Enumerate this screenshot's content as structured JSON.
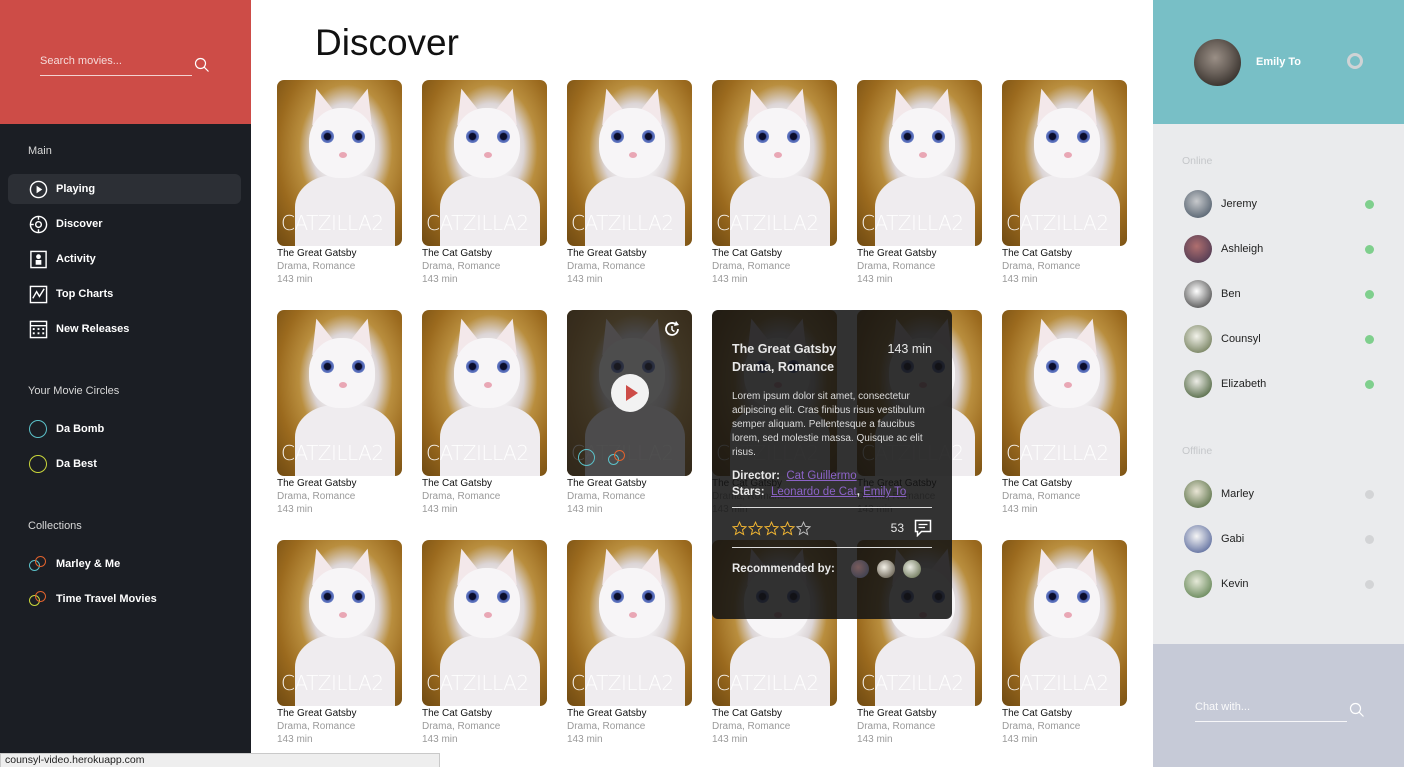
{
  "search": {
    "placeholder": "Search movies..."
  },
  "sidebar": {
    "main_title": "Main",
    "nav": [
      {
        "label": "Playing",
        "icon": "play-circle-icon",
        "active": true
      },
      {
        "label": "Discover",
        "icon": "compass-icon"
      },
      {
        "label": "Activity",
        "icon": "activity-icon"
      },
      {
        "label": "Top Charts",
        "icon": "chart-icon"
      },
      {
        "label": "New Releases",
        "icon": "calendar-icon"
      }
    ],
    "circles_title": "Your Movie Circles",
    "circles": [
      {
        "label": "Da Bomb",
        "color": "#5bc0c8"
      },
      {
        "label": "Da Best",
        "color": "#c9d63a"
      }
    ],
    "collections_title": "Collections",
    "collections": [
      {
        "label": "Marley & Me",
        "colors": [
          "#5bc0c8",
          "#e0622d"
        ]
      },
      {
        "label": "Time Travel Movies",
        "colors": [
          "#c9d63a",
          "#e0622d"
        ]
      }
    ]
  },
  "main": {
    "title": "Discover",
    "poster_text": "CATZILLA2",
    "movies": [
      {
        "name": "The Great Gatsby",
        "genre": "Drama, Romance",
        "duration": "143 min"
      },
      {
        "name": "The Cat Gatsby",
        "genre": "Drama, Romance",
        "duration": "143 min"
      },
      {
        "name": "The Great Gatsby",
        "genre": "Drama, Romance",
        "duration": "143 min"
      },
      {
        "name": "The Cat Gatsby",
        "genre": "Drama, Romance",
        "duration": "143 min"
      },
      {
        "name": "The Great Gatsby",
        "genre": "Drama, Romance",
        "duration": "143 min"
      },
      {
        "name": "The Cat Gatsby",
        "genre": "Drama, Romance",
        "duration": "143 min"
      },
      {
        "name": "The Great Gatsby",
        "genre": "Drama, Romance",
        "duration": "143 min"
      },
      {
        "name": "The Cat Gatsby",
        "genre": "Drama, Romance",
        "duration": "143 min"
      },
      {
        "name": "The Great Gatsby",
        "genre": "Drama, Romance",
        "duration": "143 min"
      },
      {
        "name": "The Cat Gatsby",
        "genre": "Drama, Romance",
        "duration": "143 min"
      },
      {
        "name": "The Great Gatsby",
        "genre": "Drama, Romance",
        "duration": "143 min"
      },
      {
        "name": "The Cat Gatsby",
        "genre": "Drama, Romance",
        "duration": "143 min"
      },
      {
        "name": "The Great Gatsby",
        "genre": "Drama, Romance",
        "duration": "143 min"
      },
      {
        "name": "The Cat Gatsby",
        "genre": "Drama, Romance",
        "duration": "143 min"
      },
      {
        "name": "The Great Gatsby",
        "genre": "Drama, Romance",
        "duration": "143 min"
      },
      {
        "name": "The Cat Gatsby",
        "genre": "Drama, Romance",
        "duration": "143 min"
      },
      {
        "name": "The Great Gatsby",
        "genre": "Drama, Romance",
        "duration": "143 min"
      },
      {
        "name": "The Cat Gatsby",
        "genre": "Drama, Romance",
        "duration": "143 min"
      }
    ]
  },
  "detail": {
    "title": "The Great Gatsby",
    "duration": "143 min",
    "genres": "Drama, Romance",
    "description": "Lorem ipsum dolor sit amet, consectetur adipiscing elit. Cras finibus risus vestibulum semper aliquam. Pellentesque a faucibus lorem, sed molestie massa. Quisque ac elit risus.",
    "director_label": "Director:",
    "director": "Cat Guillermo",
    "stars_label": "Stars:",
    "stars": [
      "Leonardo de Cat",
      "Emily To"
    ],
    "stars_separator": ", ",
    "rating": 0,
    "rating_max": 5,
    "comment_count": "53",
    "recommended_label": "Recommended by:"
  },
  "profile": {
    "name": "Emily To"
  },
  "friends": {
    "online_title": "Online",
    "online": [
      {
        "name": "Jeremy",
        "color": "#7fcf8d"
      },
      {
        "name": "Ashleigh",
        "color": "#7fcf8d"
      },
      {
        "name": "Ben",
        "color": "#7fcf8d"
      },
      {
        "name": "Counsyl",
        "color": "#7fcf8d"
      },
      {
        "name": "Elizabeth",
        "color": "#7fcf8d"
      }
    ],
    "offline_title": "Offline",
    "offline": [
      {
        "name": "Marley",
        "color": "#d3d4d6"
      },
      {
        "name": "Gabi",
        "color": "#d3d4d6"
      },
      {
        "name": "Kevin",
        "color": "#d3d4d6"
      }
    ]
  },
  "chat": {
    "placeholder": "Chat with..."
  },
  "status_bar": {
    "url": "counsyl-video.herokuapp.com"
  }
}
